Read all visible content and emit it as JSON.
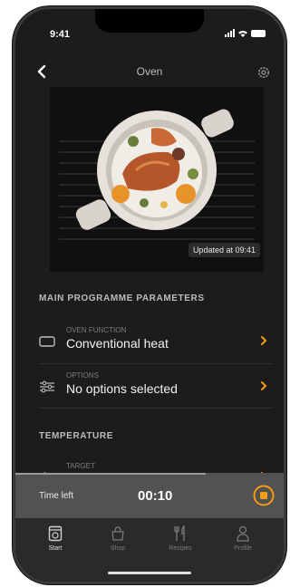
{
  "status_bar": {
    "time": "9:41"
  },
  "nav": {
    "title": "Oven"
  },
  "hero": {
    "updated": "Updated at 09:41"
  },
  "main_parameters": {
    "header": "MAIN PROGRAMME PARAMETERS",
    "oven_function": {
      "label": "OVEN FUNCTION",
      "value": "Conventional heat"
    },
    "options": {
      "label": "OPTIONS",
      "value": "No options selected"
    }
  },
  "temperature": {
    "header": "TEMPERATURE",
    "target": {
      "label": "TARGET"
    }
  },
  "timer": {
    "label": "Time left",
    "value": "00:10",
    "progress": 0.71
  },
  "tabs": [
    {
      "label": "Start",
      "icon": "oven-icon",
      "active": true
    },
    {
      "label": "Shop",
      "icon": "shopping-bag-icon",
      "active": false
    },
    {
      "label": "Recipes",
      "icon": "cutlery-icon",
      "active": false
    },
    {
      "label": "Profile",
      "icon": "profile-icon",
      "active": false
    }
  ],
  "colors": {
    "accent": "#f39c12",
    "background": "#1c1c1e"
  }
}
